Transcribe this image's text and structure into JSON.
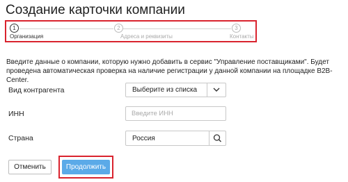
{
  "page": {
    "title": "Создание карточки компании"
  },
  "steps": [
    {
      "number": "1",
      "label": "Организация",
      "state": "active"
    },
    {
      "number": "2",
      "label": "Адреса и реквизиты",
      "state": "inactive"
    },
    {
      "number": "3",
      "label": "Контакты",
      "state": "inactive"
    }
  ],
  "intro_text": "Введите данные о компании, которую нужно добавить в сервис \"Управление поставщиками\". Будет проведена автоматическая проверка на наличие регистрации у данной компании на площадке B2B-Center.",
  "form": {
    "counterparty_type": {
      "label": "Вид контрагента",
      "value": "Выберите из списка"
    },
    "inn": {
      "label": "ИНН",
      "value": "",
      "placeholder": "Введите ИНН"
    },
    "country": {
      "label": "Страна",
      "value": "Россия"
    }
  },
  "buttons": {
    "cancel": "Отменить",
    "continue": "Продолжить"
  },
  "colors": {
    "highlight": "#d9232e",
    "primary_button": "#5baae8"
  },
  "icons": {
    "select_arrow": "chevron-down-icon",
    "country_search": "search-icon"
  }
}
